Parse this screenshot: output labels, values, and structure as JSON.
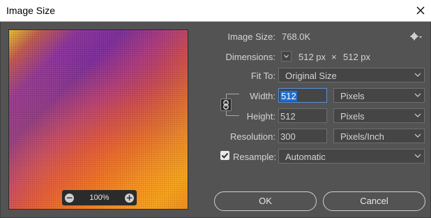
{
  "window": {
    "title": "Image Size"
  },
  "preview": {
    "zoom": "100%"
  },
  "image_size": {
    "label": "Image Size:",
    "value": "768.0K"
  },
  "dimensions": {
    "label": "Dimensions:",
    "width": "512 px",
    "times": "×",
    "height": "512 px"
  },
  "fit_to": {
    "label": "Fit To:",
    "value": "Original Size"
  },
  "width": {
    "label": "Width:",
    "value": "512",
    "unit": "Pixels"
  },
  "height": {
    "label": "Height:",
    "value": "512",
    "unit": "Pixels"
  },
  "resolution": {
    "label": "Resolution:",
    "value": "300",
    "unit": "Pixels/Inch"
  },
  "resample": {
    "label": "Resample:",
    "checked": true,
    "value": "Automatic"
  },
  "buttons": {
    "ok": "OK",
    "cancel": "Cancel"
  },
  "colors": {
    "dialog_bg": "#535353",
    "field_bg": "#454545",
    "selection": "#1f6fd1"
  }
}
